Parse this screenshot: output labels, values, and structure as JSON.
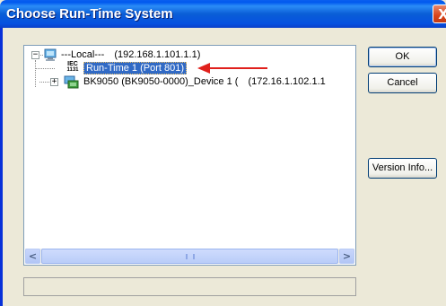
{
  "window": {
    "title": "Choose Run-Time System",
    "close_glyph": "X"
  },
  "tree": {
    "nodes": [
      {
        "label": "---Local---",
        "address": "(192.168.1.101.1.1)",
        "icon": "computer-icon",
        "expanded": true
      },
      {
        "label": "Run-Time 1 (Port 801)",
        "icon": "iec-1131-icon",
        "icon_text_top": "IEC",
        "icon_text_bottom": "1131",
        "selected": true
      },
      {
        "label": "BK9050 (BK9050-0000)_Device 1 (",
        "address": "(172.16.1.102.1.1",
        "icon": "network-device-icon",
        "expanded": false
      }
    ],
    "expander_minus": "−",
    "expander_plus": "+"
  },
  "scrollbar": {
    "left_arrow": "<",
    "right_arrow": ">"
  },
  "buttons": {
    "ok": "OK",
    "cancel": "Cancel",
    "version_info": "Version Info..."
  },
  "colors": {
    "selection": "#316ac5",
    "annotation_arrow": "#e0201c",
    "title_bar": "#0058ee"
  }
}
